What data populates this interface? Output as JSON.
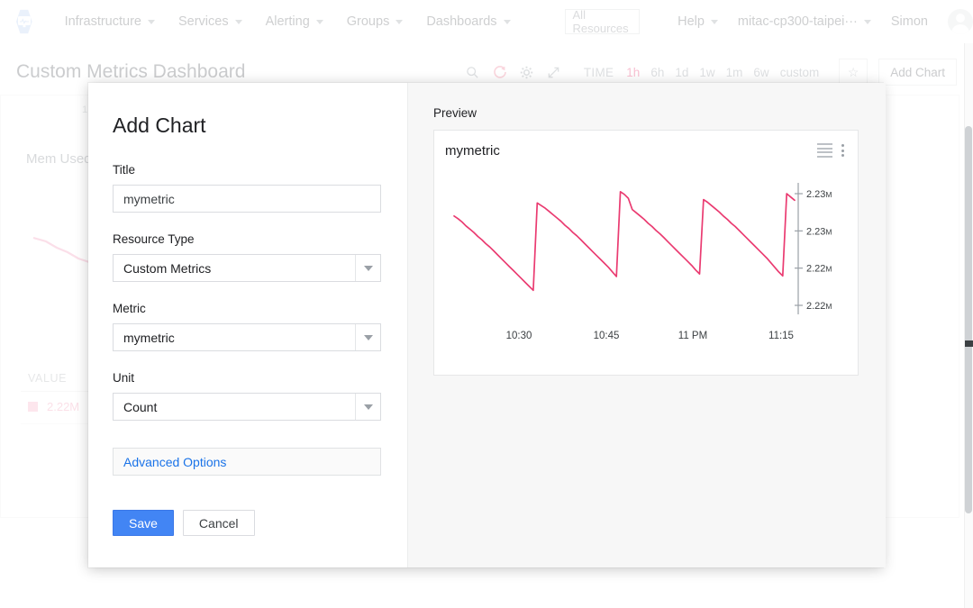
{
  "topnav": {
    "logo_icon": "monitoring-hex-logo",
    "items": [
      {
        "label": "Infrastructure",
        "icon": "chevron-down-icon"
      },
      {
        "label": "Services",
        "icon": "chevron-down-icon"
      },
      {
        "label": "Alerting",
        "icon": "chevron-down-icon"
      },
      {
        "label": "Groups",
        "icon": "chevron-down-icon"
      },
      {
        "label": "Dashboards",
        "icon": "chevron-down-icon"
      }
    ],
    "search": {
      "value": "All Resources",
      "placeholder": "All Resources"
    },
    "right_items": [
      {
        "label": "Help",
        "icon": "chevron-down-icon"
      },
      {
        "label": "mitac-cp300-taipei···",
        "icon": "chevron-down-icon"
      }
    ],
    "user": "Simon",
    "avatar_icon": "avatar-icon"
  },
  "toolbar": {
    "page_title": "Custom Metrics Dashboard",
    "icons": [
      "search-icon",
      "refresh-icon",
      "gear-icon",
      "expand-icon"
    ],
    "time_label": "TIME",
    "ranges": [
      "1h",
      "6h",
      "1d",
      "1w",
      "1m",
      "6w",
      "custom"
    ],
    "active_range": "1h",
    "star_icon": "star-icon",
    "add_chart_label": "Add Chart"
  },
  "background_card": {
    "title": "Mem Used",
    "corner_number": "1",
    "legend_header": "VALUE",
    "legend_value": "2.22M",
    "swatch_color": "#f9b6cb"
  },
  "modal": {
    "title": "Add Chart",
    "fields": {
      "title": {
        "label": "Title",
        "value": "mymetric",
        "placeholder": "mymetric"
      },
      "resource_type": {
        "label": "Resource Type",
        "value": "Custom Metrics",
        "arrow_icon": "caret-down-icon"
      },
      "metric": {
        "label": "Metric",
        "value": "mymetric",
        "arrow_icon": "caret-down-icon"
      },
      "unit": {
        "label": "Unit",
        "value": "Count",
        "arrow_icon": "caret-down-icon"
      }
    },
    "advanced_options_label": "Advanced Options",
    "save_label": "Save",
    "cancel_label": "Cancel",
    "save_color": "#4285f4",
    "link_color": "#1a73e8"
  },
  "preview": {
    "label": "Preview",
    "card_title": "mymetric",
    "menu_icon": "hamburger-icon",
    "more_icon": "more-vertical-icon"
  },
  "chart_data": {
    "type": "line",
    "title": "mymetric",
    "xlabel": "",
    "ylabel": "",
    "line_color": "#ea3b71",
    "grid": false,
    "legend": "none",
    "y_axis_position": "right",
    "x_ticks": [
      "10:30",
      "10:45",
      "11 PM",
      "11:15"
    ],
    "y_ticks": [
      "2.23M",
      "2.23M",
      "2.22M",
      "2.22M"
    ],
    "ylim": [
      2215000,
      2235000
    ],
    "unit": "Count",
    "series": [
      {
        "name": "mymetric",
        "description": "Sawtooth memory counter: four descending ramps with sharp resets",
        "values": [
          2230500,
          2230100,
          2229600,
          2229000,
          2228500,
          2228000,
          2227400,
          2226900,
          2226300,
          2225800,
          2225200,
          2224600,
          2224000,
          2223400,
          2222800,
          2222200,
          2221600,
          2221000,
          2220400,
          2219800,
          2219200,
          2232500,
          2232100,
          2231700,
          2231200,
          2230700,
          2230200,
          2229700,
          2229100,
          2228600,
          2228000,
          2227500,
          2226900,
          2226300,
          2225700,
          2225100,
          2224500,
          2223900,
          2223300,
          2222700,
          2222000,
          2221300,
          2234200,
          2233800,
          2233200,
          2231500,
          2231000,
          2230500,
          2230000,
          2229400,
          2228900,
          2228300,
          2227800,
          2227200,
          2226600,
          2226000,
          2225400,
          2224800,
          2224200,
          2223600,
          2223000,
          2222300,
          2221700,
          2233000,
          2232600,
          2232100,
          2231600,
          2231100,
          2230500,
          2230000,
          2229400,
          2228900,
          2228300,
          2227700,
          2227100,
          2226500,
          2225900,
          2225300,
          2224700,
          2224100,
          2223400,
          2222700,
          2222000,
          2221400,
          2233900,
          2233400,
          2232900
        ]
      }
    ]
  }
}
